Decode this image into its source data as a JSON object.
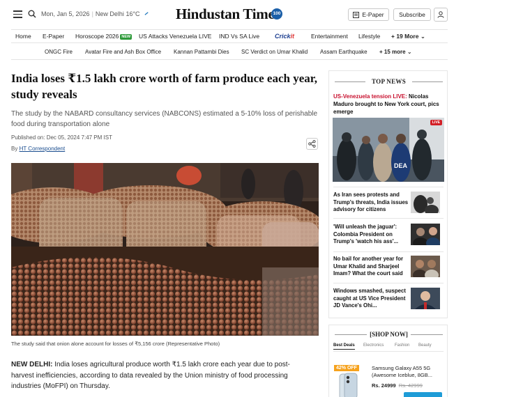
{
  "header": {
    "date": "Mon, Jan 5, 2026",
    "location": "New Delhi",
    "temperature": "16°C",
    "logo_text": "Hindustan Times",
    "logo_badge": "100",
    "epaper_label": "E-Paper",
    "subscribe_label": "Subscribe"
  },
  "nav_primary": {
    "home": "Home",
    "epaper": "E-Paper",
    "horoscope": "Horoscope 2026",
    "horoscope_badge": "NEW",
    "us_attacks": "US Attacks Venezuela LIVE",
    "ind_sa": "IND Vs SA Live",
    "cricket_a": "Crick",
    "cricket_b": "it",
    "entertainment": "Entertainment",
    "lifestyle": "Lifestyle",
    "more": "+ 19 More"
  },
  "nav_secondary": {
    "item1": "ONGC Fire",
    "item2": "Avatar Fire and Ash Box Office",
    "item3": "Kannan Pattambi Dies",
    "item4": "SC Verdict on Umar Khalid",
    "item5": "Assam Earthquake",
    "more": "+ 15 more"
  },
  "article": {
    "headline": "India loses ₹1.5 lakh crore worth of farm produce each year, study reveals",
    "summary": "The study by the NABARD consultancy services (NABCONS) estimated a 5-10% loss of perishable food during transportation alone",
    "published": "Published on: Dec 05, 2024 7:47 PM IST",
    "by": "By ",
    "author": "HT Correspondent",
    "caption": "The study said that onion alone account for losses of ₹5,156 crore (Representative Photo)",
    "dateline": "NEW DELHI:",
    "body": " India loses agricultural produce worth ₹1.5 lakh crore each year due to post-harvest inefficiencies, according to data revealed by the Union ministry of food processing industries (MoFPI) on Thursday."
  },
  "top_news": {
    "title": "TOP NEWS",
    "lead_prefix": "US-Venezuela tension LIVE: ",
    "lead_rest": "Nicolas Maduro brought to New York court, pics emerge",
    "live_tag": "LIVE",
    "photo_vest_text": "DEA",
    "stories": [
      {
        "text": "As Iran sees protests and Trump's threats, India issues advisory for citizens"
      },
      {
        "text": "'Will unleash the jaguar': Colombia President on Trump's 'watch his ass'..."
      },
      {
        "text": "No bail for another year for Umar Khalid and Sharjeel Imam? What the court said"
      },
      {
        "text": "Windows smashed, suspect caught at US Vice President JD Vance's Ohi..."
      }
    ]
  },
  "shop_now": {
    "title": "[SHOP NOW]",
    "tabs": [
      "Best Deals",
      "Electronics",
      "Fashion",
      "Beauty"
    ],
    "discount": "42% OFF",
    "product": "Samsung Galaxy A55 5G (Awesome Iceblue, 8GB...",
    "price": "Rs. 24999",
    "mrp": "Rs. 42999"
  }
}
